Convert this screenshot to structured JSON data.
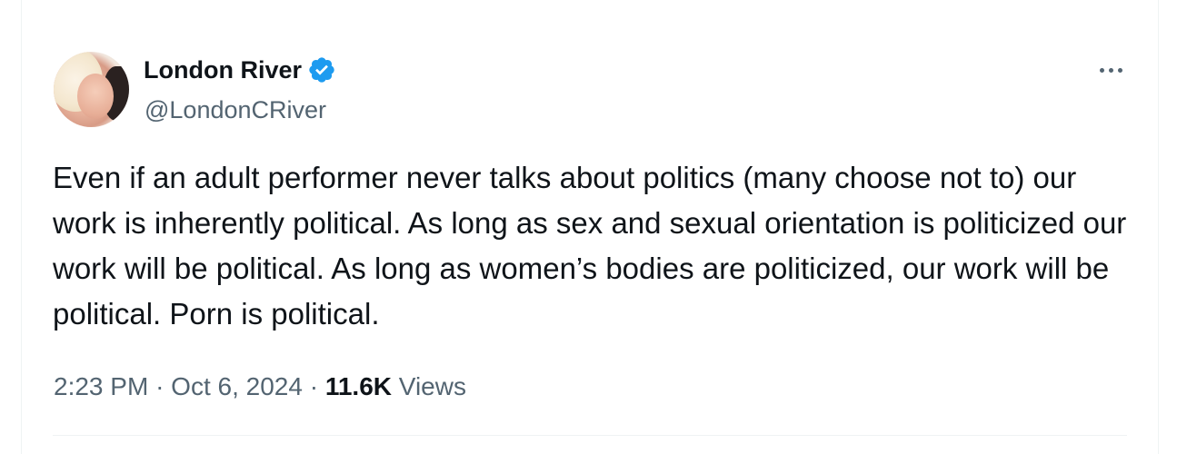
{
  "author": {
    "name": "London River",
    "handle": "@LondonCRiver",
    "verified": true
  },
  "tweet": {
    "text": "Even if an adult performer never talks about politics (many choose not to) our work is inherently political. As long as sex and sexual orientation is politicized our work will be political. As long as women’s bodies are politicized, our work will be political. Porn is political."
  },
  "meta": {
    "time": "2:23 PM",
    "separator": "·",
    "date": "Oct 6, 2024",
    "views_count": "11.6K",
    "views_label": "Views"
  },
  "icons": {
    "verified": "verified-badge-icon",
    "more": "more-options-icon"
  },
  "colors": {
    "verified": "#1d9bf0",
    "text": "#0f1419",
    "secondary": "#536471"
  }
}
